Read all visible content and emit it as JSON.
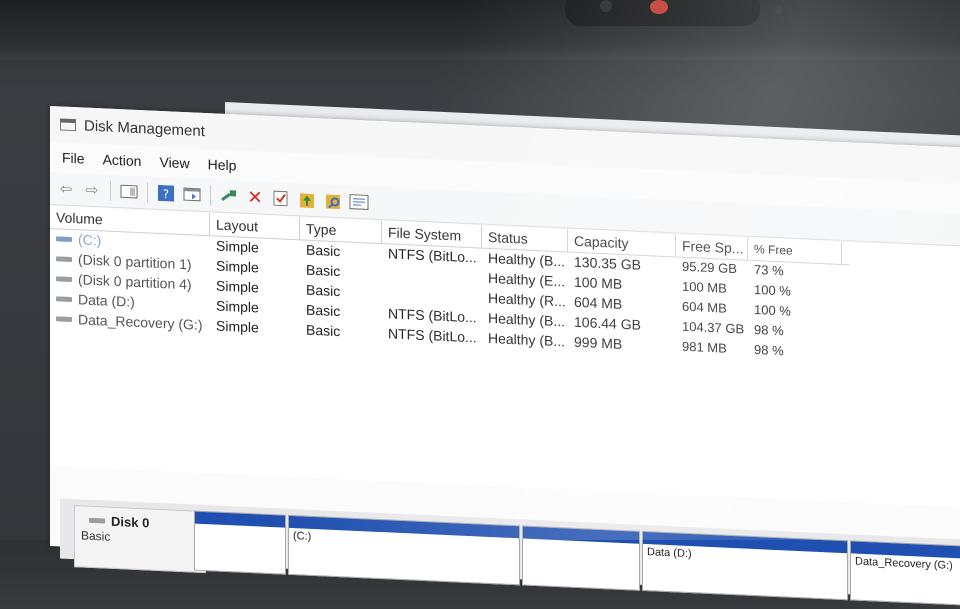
{
  "window": {
    "title": "Disk Management"
  },
  "menu": [
    "File",
    "Action",
    "View",
    "Help"
  ],
  "toolbar_icons": [
    "back-arrow-icon",
    "forward-arrow-icon",
    "console-tree-icon",
    "help-icon",
    "properties-icon",
    "connect-icon",
    "delete-icon",
    "check-icon",
    "up-folder-icon",
    "search-folder-icon",
    "list-view-icon"
  ],
  "table": {
    "headers": [
      "Volume",
      "Layout",
      "Type",
      "File System",
      "Status",
      "Capacity",
      "Free Sp...",
      "% Free"
    ],
    "rows": [
      {
        "volume": "(C:)",
        "layout": "Simple",
        "type": "Basic",
        "fs": "NTFS (BitLo...",
        "status": "Healthy (B...",
        "capacity": "130.35 GB",
        "free": "95.29 GB",
        "pct": "73 %",
        "selected": true
      },
      {
        "volume": "(Disk 0 partition 1)",
        "layout": "Simple",
        "type": "Basic",
        "fs": "",
        "status": "Healthy (E...",
        "capacity": "100 MB",
        "free": "100 MB",
        "pct": "100 %",
        "selected": false
      },
      {
        "volume": "(Disk 0 partition 4)",
        "layout": "Simple",
        "type": "Basic",
        "fs": "",
        "status": "Healthy (R...",
        "capacity": "604 MB",
        "free": "604 MB",
        "pct": "100 %",
        "selected": false
      },
      {
        "volume": "Data (D:)",
        "layout": "Simple",
        "type": "Basic",
        "fs": "NTFS (BitLo...",
        "status": "Healthy (B...",
        "capacity": "106.44 GB",
        "free": "104.37 GB",
        "pct": "98 %",
        "selected": false
      },
      {
        "volume": "Data_Recovery (G:)",
        "layout": "Simple",
        "type": "Basic",
        "fs": "NTFS (BitLo...",
        "status": "Healthy (B...",
        "capacity": "999 MB",
        "free": "981 MB",
        "pct": "98 %",
        "selected": false
      }
    ]
  },
  "disk_map": {
    "disk_name": "Disk 0",
    "disk_type": "Basic",
    "partitions": [
      {
        "label": ""
      },
      {
        "label": "(C:)"
      },
      {
        "label": ""
      },
      {
        "label": "Data (D:)"
      },
      {
        "label": "Data_Recovery (G:)"
      }
    ]
  },
  "colors": {
    "partition_bar": "#1f4fb0",
    "delete_icon": "#d42a1e",
    "selected_volume_text": "#8aa4c8"
  }
}
